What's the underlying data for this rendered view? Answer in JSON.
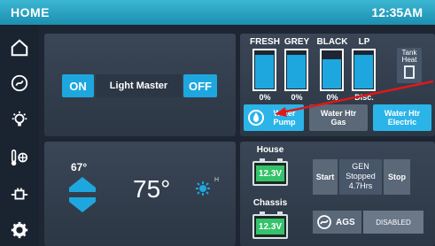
{
  "header": {
    "title": "HOME",
    "time": "12:35AM"
  },
  "sidebar": {
    "items": [
      {
        "icon": "home-icon"
      },
      {
        "icon": "generator-icon"
      },
      {
        "icon": "light-bulb-icon"
      },
      {
        "icon": "thermostat-fan-icon"
      },
      {
        "icon": "power-plug-icon"
      },
      {
        "icon": "gear-icon"
      }
    ]
  },
  "lights": {
    "on_label": "ON",
    "master_label": "Light Master",
    "off_label": "OFF"
  },
  "tanks": {
    "items": [
      {
        "label": "FRESH",
        "percent": "0%",
        "level": 0.9
      },
      {
        "label": "GREY",
        "percent": "0%",
        "level": 0.9
      },
      {
        "label": "BLACK",
        "percent": "0%",
        "level": 0.8
      },
      {
        "label": "LP",
        "percent": "Disc.",
        "level": 0.9
      }
    ],
    "heat_label_line1": "Tank",
    "heat_label_line2": "Heat"
  },
  "water": {
    "pump_line1": "Water",
    "pump_line2": "Pump",
    "gas_line1": "Water Htr",
    "gas_line2": "Gas",
    "electric_line1": "Water Htr",
    "electric_line2": "Electric"
  },
  "climate": {
    "setpoint": "67°",
    "current": "75°",
    "fan_mark": "H"
  },
  "power": {
    "house_label": "House",
    "house_voltage": "12.3V",
    "chassis_label": "Chassis",
    "chassis_voltage": "12.3V",
    "gen_start": "Start",
    "gen_line1": "GEN",
    "gen_line2": "Stopped",
    "gen_line3": "4.7Hrs",
    "gen_stop": "Stop",
    "ags_label": "AGS",
    "ags_status": "DISABLED"
  },
  "colors": {
    "accent": "#1ea7de",
    "battery_green": "#34c26a",
    "annotation_red": "#e01818",
    "header": "#2aa6c8"
  }
}
